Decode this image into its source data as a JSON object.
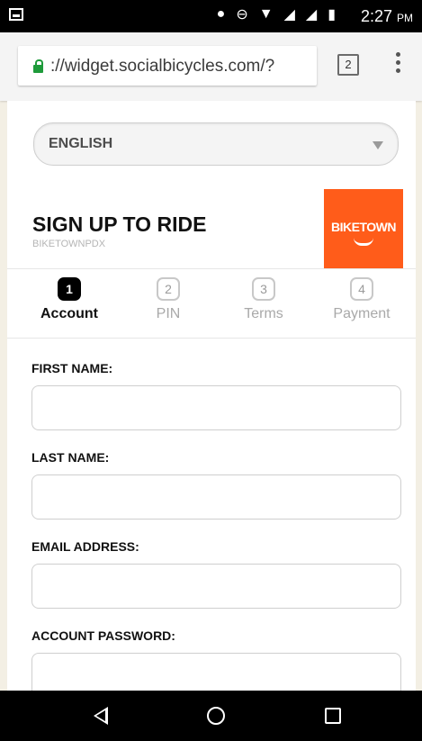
{
  "status_bar": {
    "time": "2:27",
    "ampm": "PM",
    "icons": [
      "location-icon",
      "do-not-disturb-icon",
      "wifi-icon",
      "signal-h-icon",
      "signal-r-icon",
      "signal-g-icon",
      "battery-icon"
    ]
  },
  "browser": {
    "url": "://widget.socialbicycles.com/?",
    "tab_count": "2"
  },
  "language": {
    "selected": "ENGLISH"
  },
  "header": {
    "title": "SIGN UP TO RIDE",
    "subtitle": "BIKETOWNPDX",
    "logo_text": "BIKETOWN",
    "logo_color": "#ff5c1a"
  },
  "steps": [
    {
      "number": "1",
      "label": "Account",
      "active": true
    },
    {
      "number": "2",
      "label": "PIN",
      "active": false
    },
    {
      "number": "3",
      "label": "Terms",
      "active": false
    },
    {
      "number": "4",
      "label": "Payment",
      "active": false
    }
  ],
  "form": {
    "first_name_label": "FIRST NAME:",
    "first_name_value": "",
    "last_name_label": "LAST NAME:",
    "last_name_value": "",
    "email_label": "EMAIL ADDRESS:",
    "email_value": "",
    "password_label": "ACCOUNT PASSWORD:",
    "password_value": ""
  }
}
